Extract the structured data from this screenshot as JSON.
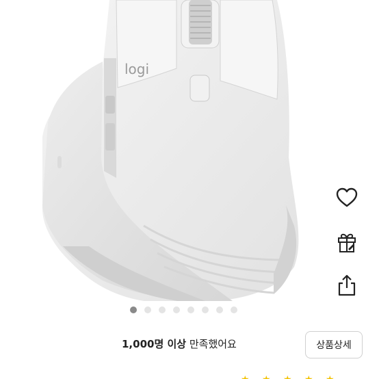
{
  "product": {
    "brand_logo": "logi",
    "image_alt": "Logitech MX Master mouse, pale grey"
  },
  "actions": {
    "wishlist_icon": "heart-icon",
    "gift_icon": "gift-icon",
    "share_icon": "share-icon"
  },
  "carousel": {
    "total": 8,
    "active_index": 0
  },
  "satisfaction": {
    "count": "1,000명 이상",
    "text": "만족했어요"
  },
  "detail_button": {
    "label": "상품상세"
  },
  "colors": {
    "star": "#f2c200",
    "dot_active": "#8a8a8a",
    "dot_inactive": "#e4e4e4"
  }
}
